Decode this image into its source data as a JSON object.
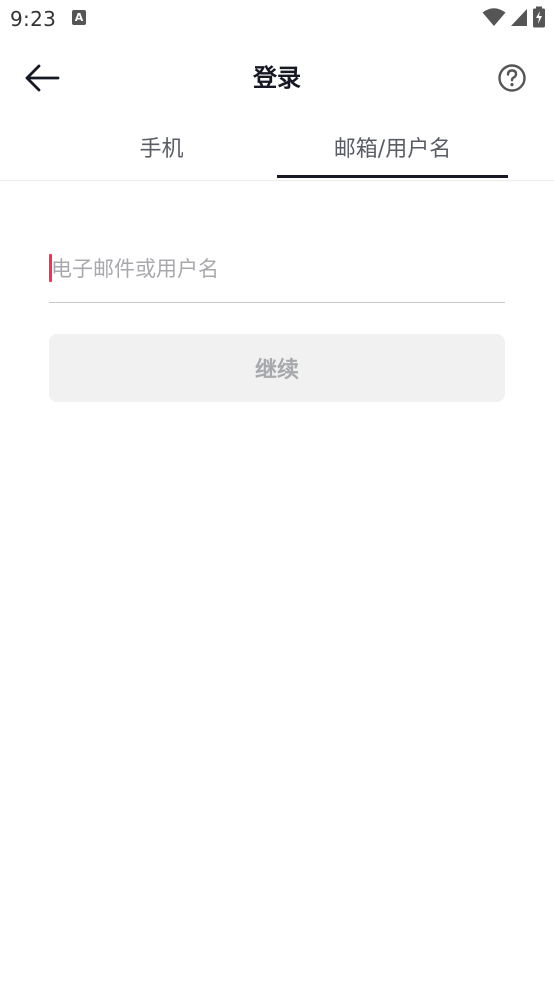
{
  "status_bar": {
    "time": "9:23",
    "notification_icon": "a-notification-icon",
    "wifi_icon": "wifi-icon",
    "signal_icon": "signal-icon",
    "battery_icon": "battery-charging-icon"
  },
  "header": {
    "title": "登录",
    "back_icon": "arrow-left-icon",
    "help_icon": "question-circle-icon"
  },
  "tabs": [
    {
      "label": "手机",
      "active": false
    },
    {
      "label": "邮箱/用户名",
      "active": true
    }
  ],
  "form": {
    "email_value": "",
    "email_placeholder": "电子邮件或用户名",
    "continue_label": "继续"
  },
  "colors": {
    "accent": "#fe2c55",
    "text_primary": "#161823",
    "text_secondary": "#5a5c66",
    "placeholder": "#a8a9ad",
    "button_disabled_bg": "#f1f1f2"
  }
}
